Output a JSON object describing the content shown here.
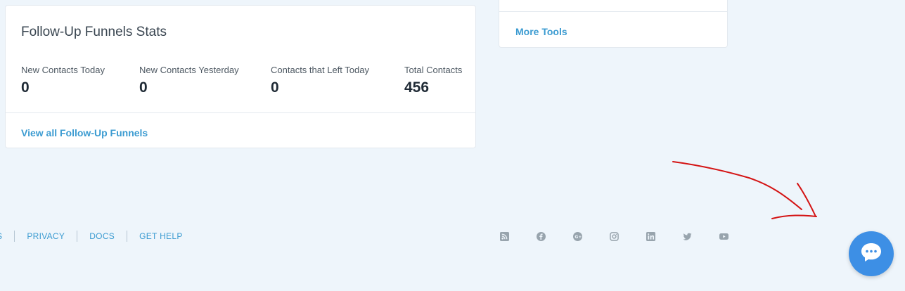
{
  "funnel_stats": {
    "title": "Follow-Up Funnels Stats",
    "stats": [
      {
        "label": "New Contacts Today",
        "value": "0"
      },
      {
        "label": "New Contacts Yesterday",
        "value": "0"
      },
      {
        "label": "Contacts that Left Today",
        "value": "0"
      },
      {
        "label": "Total Contacts",
        "value": "456"
      }
    ],
    "link": "View all Follow-Up Funnels"
  },
  "tools_card": {
    "link": "More Tools"
  },
  "footer": {
    "links": [
      "S",
      "PRIVACY",
      "DOCS",
      "GET HELP"
    ]
  },
  "social_icons": [
    "rss-icon",
    "facebook-icon",
    "google-plus-icon",
    "instagram-icon",
    "linkedin-icon",
    "twitter-icon",
    "youtube-icon"
  ],
  "chat": {
    "icon": "chat-bubble-icon",
    "color": "#3d8fe5"
  },
  "colors": {
    "accent": "#3b9bd1",
    "background": "#eef5fb",
    "annotation": "#d41414"
  }
}
